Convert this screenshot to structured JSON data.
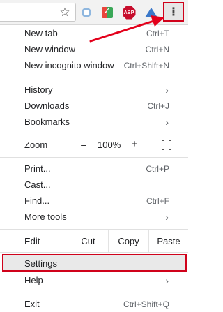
{
  "toolbar": {
    "star_icon": "☆",
    "abp_label": "ABP",
    "menu_icon": "⋮"
  },
  "menu": {
    "new_tab": {
      "label": "New tab",
      "shortcut": "Ctrl+T"
    },
    "new_window": {
      "label": "New window",
      "shortcut": "Ctrl+N"
    },
    "new_incognito": {
      "label": "New incognito window",
      "shortcut": "Ctrl+Shift+N"
    },
    "history": {
      "label": "History",
      "chevron": "›"
    },
    "downloads": {
      "label": "Downloads",
      "shortcut": "Ctrl+J"
    },
    "bookmarks": {
      "label": "Bookmarks",
      "chevron": "›"
    },
    "zoom": {
      "label": "Zoom",
      "minus": "–",
      "value": "100%",
      "plus": "+"
    },
    "print": {
      "label": "Print...",
      "shortcut": "Ctrl+P"
    },
    "cast": {
      "label": "Cast..."
    },
    "find": {
      "label": "Find...",
      "shortcut": "Ctrl+F"
    },
    "more_tools": {
      "label": "More tools",
      "chevron": "›"
    },
    "edit": {
      "label": "Edit",
      "cut": "Cut",
      "copy": "Copy",
      "paste": "Paste"
    },
    "settings": {
      "label": "Settings"
    },
    "help": {
      "label": "Help",
      "chevron": "›"
    },
    "exit": {
      "label": "Exit",
      "shortcut": "Ctrl+Shift+Q"
    }
  },
  "colors": {
    "highlight_border": "#d0021b",
    "arrow": "#e3001b"
  }
}
